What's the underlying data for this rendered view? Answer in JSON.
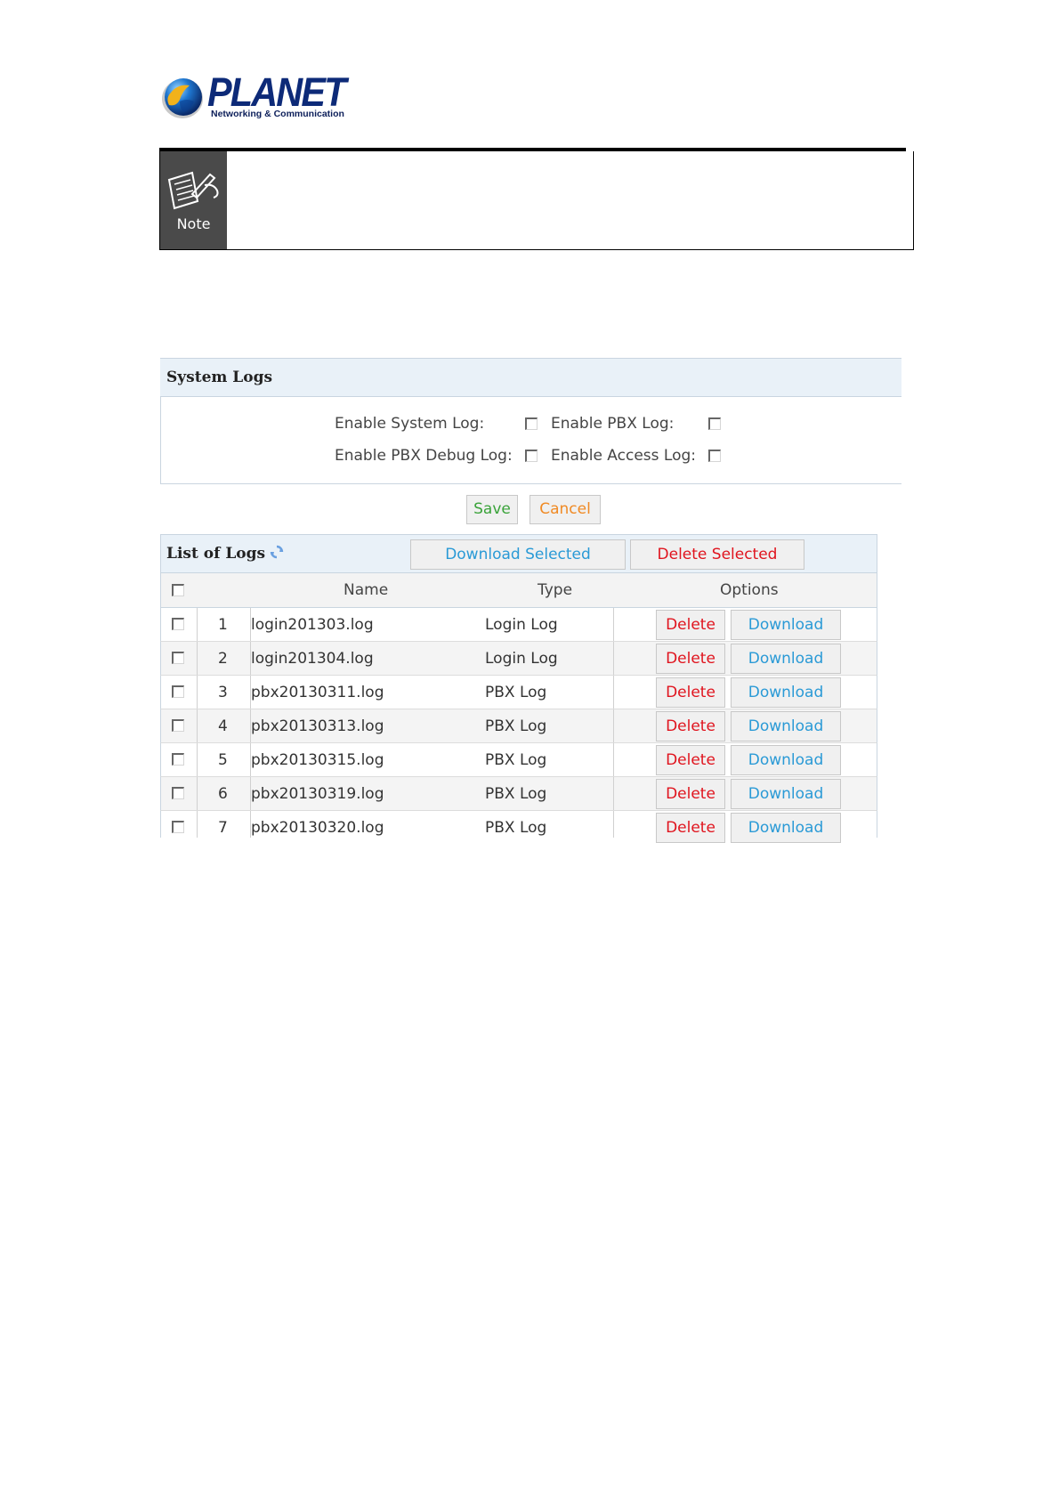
{
  "logo": {
    "brand": "PLANET",
    "tagline": "Networking & Communication"
  },
  "note": {
    "label": "Note"
  },
  "system_logs": {
    "title": "System Logs",
    "options": [
      {
        "label": "Enable System Log:",
        "checked": false
      },
      {
        "label": "Enable PBX Log:",
        "checked": false
      },
      {
        "label": "Enable PBX Debug Log:",
        "checked": false
      },
      {
        "label": "Enable Access Log:",
        "checked": false
      }
    ],
    "save_label": "Save",
    "cancel_label": "Cancel"
  },
  "list_of_logs": {
    "title": "List of Logs",
    "download_selected_label": "Download Selected",
    "delete_selected_label": "Delete Selected",
    "columns": [
      "Name",
      "Type",
      "Options"
    ],
    "delete_label": "Delete",
    "download_label": "Download",
    "rows": [
      {
        "index": "1",
        "name": "login201303.log",
        "type": "Login Log"
      },
      {
        "index": "2",
        "name": "login201304.log",
        "type": "Login Log"
      },
      {
        "index": "3",
        "name": "pbx20130311.log",
        "type": "PBX Log"
      },
      {
        "index": "4",
        "name": "pbx20130313.log",
        "type": "PBX Log"
      },
      {
        "index": "5",
        "name": "pbx20130315.log",
        "type": "PBX Log"
      },
      {
        "index": "6",
        "name": "pbx20130319.log",
        "type": "PBX Log"
      },
      {
        "index": "7",
        "name": "pbx20130320.log",
        "type": "PBX Log"
      }
    ]
  },
  "colors": {
    "brand_blue": "#0d2a78",
    "save_green": "#3aa33a",
    "cancel_orange": "#f08a24",
    "delete_red": "#e0141e",
    "download_blue": "#2a9ad6",
    "header_bg": "#e9f1f8"
  },
  "icons": [
    "planet-globe-icon",
    "note-pen-icon",
    "refresh-icon",
    "checkbox-icon"
  ]
}
